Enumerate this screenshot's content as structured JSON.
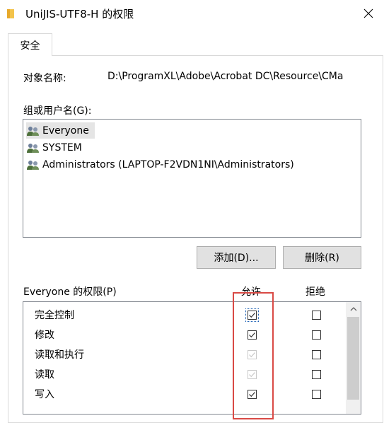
{
  "window": {
    "title": "UniJIS-UTF8-H 的权限",
    "close_icon": "close-icon"
  },
  "tabs": [
    {
      "label": "安全",
      "active": true
    }
  ],
  "object": {
    "label": "对象名称:",
    "path": "D:\\ProgramXL\\Adobe\\Acrobat DC\\Resource\\CMa"
  },
  "groups": {
    "label": "组或用户名(G):",
    "items": [
      {
        "name": "Everyone",
        "selected": true,
        "icon": "users-icon"
      },
      {
        "name": "SYSTEM",
        "selected": false,
        "icon": "users-icon"
      },
      {
        "name": "Administrators (LAPTOP-F2VDN1NI\\Administrators)",
        "selected": false,
        "icon": "users-icon"
      }
    ]
  },
  "buttons": {
    "add": "添加(D)...",
    "remove": "删除(R)"
  },
  "permissions": {
    "label": "Everyone 的权限(P)",
    "allow_header": "允许",
    "deny_header": "拒绝",
    "rows": [
      {
        "name": "完全控制",
        "allow": "checked",
        "deny": "unchecked"
      },
      {
        "name": "修改",
        "allow": "checked",
        "deny": "unchecked"
      },
      {
        "name": "读取和执行",
        "allow": "checked-disabled",
        "deny": "unchecked"
      },
      {
        "name": "读取",
        "allow": "checked-disabled",
        "deny": "unchecked"
      },
      {
        "name": "写入",
        "allow": "checked",
        "deny": "unchecked"
      }
    ]
  },
  "colors": {
    "highlight": "#d94a45",
    "selection": "#e5e5e5",
    "check_enabled": "#333333",
    "check_disabled": "#c8c8c8"
  }
}
